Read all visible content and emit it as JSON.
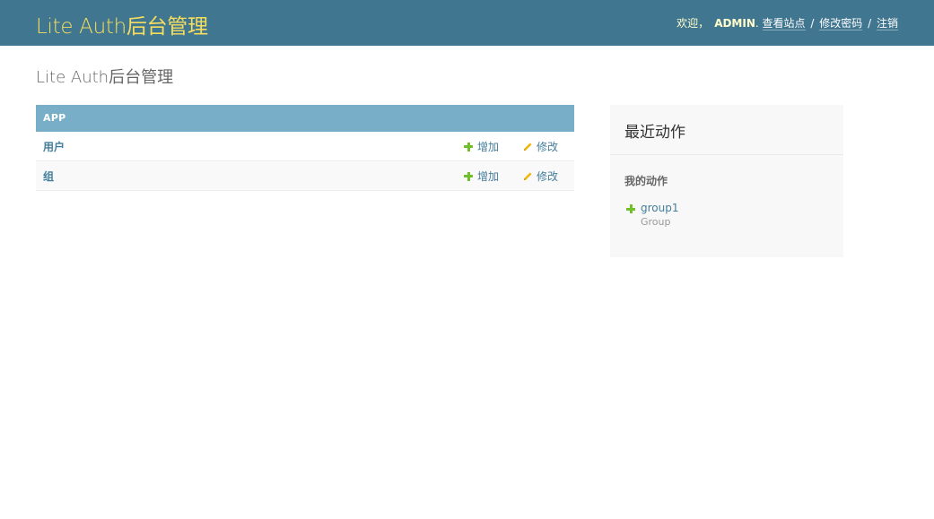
{
  "header": {
    "branding": "Lite Auth后台管理",
    "welcome": "欢迎，",
    "user_name": "ADMIN",
    "after_user": ".",
    "view_site": "查看站点",
    "change_password": "修改密码",
    "logout": "注销",
    "separator": "/"
  },
  "page": {
    "title": "Lite Auth后台管理"
  },
  "app_module": {
    "caption": "APP",
    "models": [
      {
        "name": "用户",
        "add_label": "增加",
        "change_label": "修改"
      },
      {
        "name": "组",
        "add_label": "增加",
        "change_label": "修改"
      }
    ]
  },
  "recent_actions": {
    "title": "最近动作",
    "subtitle": "我的动作",
    "items": [
      {
        "link_text": "group1",
        "type": "Group",
        "action_icon": "plus-icon"
      }
    ]
  },
  "colors": {
    "header_bg": "#417690",
    "branding": "#f5dd5d",
    "module_caption_bg": "#79aec8",
    "link": "#447e9b",
    "add_icon": "#70bf2b",
    "change_icon": "#efb80b"
  }
}
